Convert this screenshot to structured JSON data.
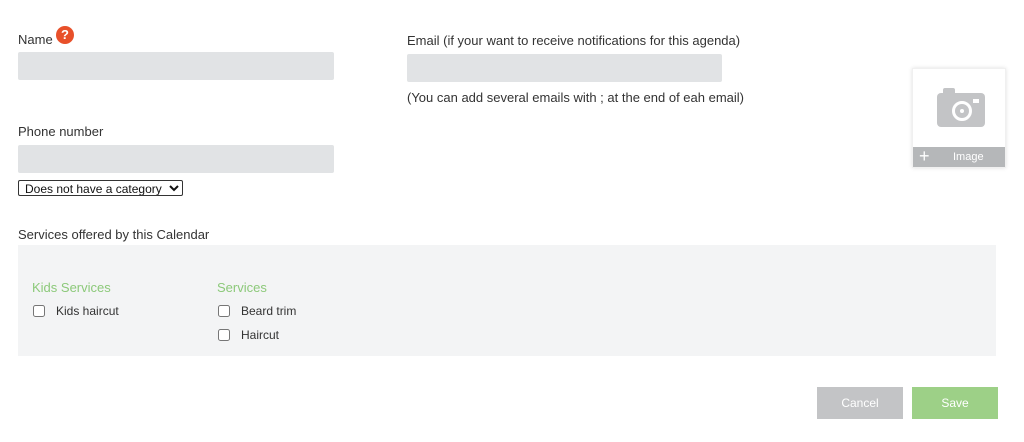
{
  "name_field": {
    "label": "Name",
    "help_icon": "question-icon",
    "help_glyph": "?",
    "value": ""
  },
  "email_field": {
    "label": "Email (if your want to receive notifications for this agenda)",
    "value": "",
    "hint": "(You can add several emails with ; at the end of eah email)"
  },
  "phone_field": {
    "label": "Phone number",
    "value": ""
  },
  "category_select": {
    "selected": "Does not have a category"
  },
  "image_upload": {
    "icon": "camera-icon",
    "plus_icon": "plus-icon",
    "plus_glyph": "+",
    "label": "Image"
  },
  "services": {
    "title": "Services offered by this Calendar",
    "groups": [
      {
        "title": "Kids Services",
        "items": [
          {
            "label": "Kids haircut",
            "checked": false
          }
        ]
      },
      {
        "title": "Services",
        "items": [
          {
            "label": "Beard trim",
            "checked": false
          },
          {
            "label": "Haircut",
            "checked": false
          }
        ]
      }
    ]
  },
  "actions": {
    "cancel_label": "Cancel",
    "save_label": "Save"
  },
  "colors": {
    "accent_green": "#8cc97a",
    "save_button": "#9dd087",
    "cancel_button": "#c3c4c6",
    "help_icon": "#e8502a"
  }
}
